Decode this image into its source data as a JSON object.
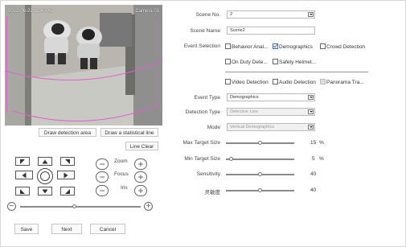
{
  "video": {
    "osd_datetime": "2022-06-22 11:40:45",
    "osd_camera": "Camera 01"
  },
  "left_buttons": {
    "draw_detection_area": "Draw detection area",
    "draw_statistical_line": "Draw a statistical line",
    "line_clear": "Line Clear"
  },
  "ptz": {
    "zoom_label": "Zoom",
    "focus_label": "Focus",
    "iris_label": "Iris",
    "speed_level": 0.45
  },
  "footer": {
    "save": "Save",
    "next": "Next",
    "cancel": "Cancel"
  },
  "form": {
    "scene_no_label": "Scene No.",
    "scene_no_value": "2",
    "scene_name_label": "Scene Name",
    "scene_name_value": "Scene2",
    "event_selection_label": "Event Selection",
    "events": [
      {
        "label": "Behavior Anal...",
        "checked": false,
        "disabled": false
      },
      {
        "label": "Demographics",
        "checked": true,
        "disabled": false
      },
      {
        "label": "Crowd Detection",
        "checked": false,
        "disabled": false
      },
      {
        "label": "On Duty Dete...",
        "checked": false,
        "disabled": false
      },
      {
        "label": "Safety Helmet...",
        "checked": false,
        "disabled": false
      },
      {
        "label": "Video Detection",
        "checked": false,
        "disabled": false
      },
      {
        "label": "Audio Detection",
        "checked": false,
        "disabled": false
      },
      {
        "label": "Panorama Tra...",
        "checked": false,
        "disabled": true
      }
    ],
    "event_type_label": "Event Type",
    "event_type_value": "Demographics",
    "detection_type_label": "Detection Type",
    "detection_type_value": "Detective Line",
    "mode_label": "Mode",
    "mode_value": "Vertical Demographics",
    "sliders": [
      {
        "label": "Max Target Size",
        "value": "15",
        "unit": "%",
        "level": 0.5
      },
      {
        "label": "Min Target Size",
        "value": "5",
        "unit": "%",
        "level": 0.05
      },
      {
        "label": "Sensitivity",
        "value": "40",
        "unit": "",
        "level": 0.5
      },
      {
        "label": "灵敏度",
        "value": "40",
        "unit": "",
        "level": 0.5
      }
    ]
  },
  "colors": {
    "accent": "#3b6fd0",
    "detection_line": "#e060d0"
  }
}
